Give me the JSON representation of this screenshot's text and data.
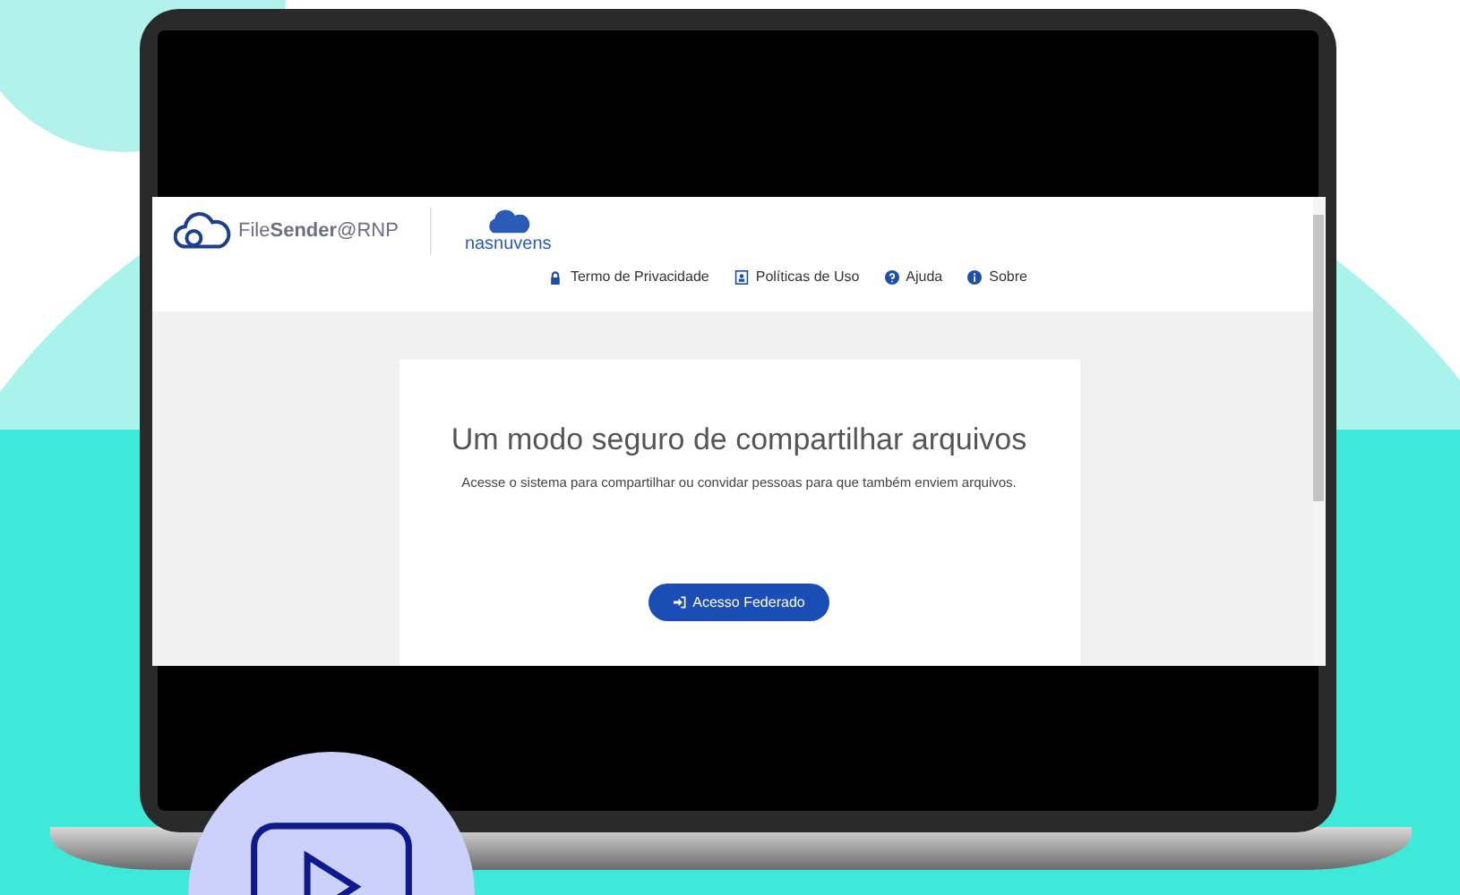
{
  "header": {
    "logo_text": "File**Sender**@RNP",
    "partner_logo_text": "nasnuvens"
  },
  "nav": [
    {
      "kind": "lock",
      "label": "Termo de Privacidade"
    },
    {
      "kind": "badge",
      "label": "Políticas de Uso"
    },
    {
      "kind": "question",
      "label": "Ajuda"
    },
    {
      "kind": "info",
      "label": "Sobre"
    }
  ],
  "card": {
    "title": "Um modo seguro de compartilhar arquivos",
    "subtitle": "Acesse o sistema para compartilhar ou convidar pessoas para que também enviem arquivos.",
    "button": "Acesso Federado"
  }
}
